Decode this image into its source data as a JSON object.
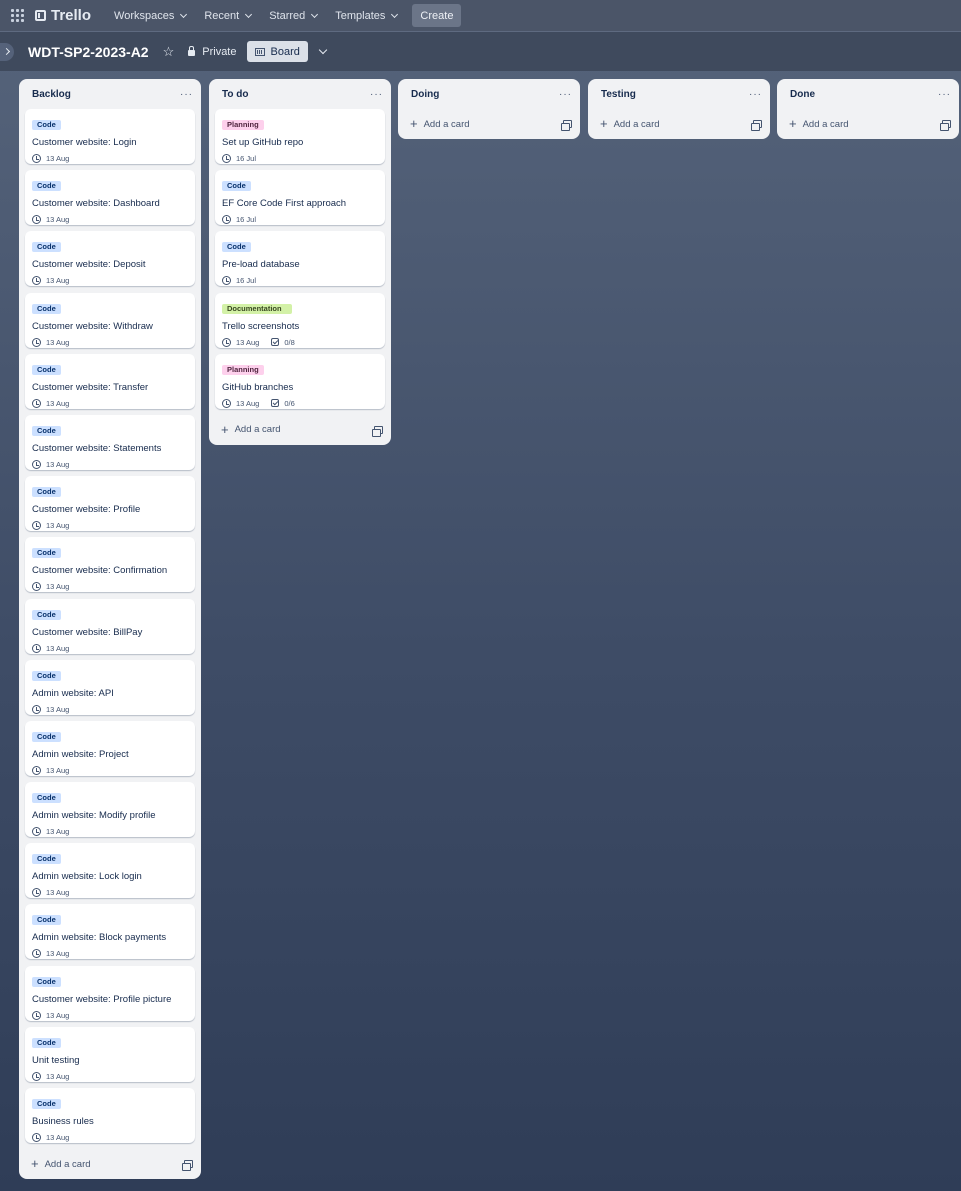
{
  "topbar": {
    "app_name": "Trello",
    "nav": [
      {
        "label": "Workspaces"
      },
      {
        "label": "Recent"
      },
      {
        "label": "Starred"
      },
      {
        "label": "Templates"
      }
    ],
    "create_label": "Create"
  },
  "board": {
    "title": "WDT-SP2-2023-A2",
    "visibility": "Private",
    "view_label": "Board",
    "add_card_label": "Add a card"
  },
  "lists": [
    {
      "title": "Backlog",
      "cards": [
        {
          "label": "Code",
          "label_type": "code",
          "title": "Customer website: Login",
          "date": "13 Aug"
        },
        {
          "label": "Code",
          "label_type": "code",
          "title": "Customer website: Dashboard",
          "date": "13 Aug"
        },
        {
          "label": "Code",
          "label_type": "code",
          "title": "Customer website: Deposit",
          "date": "13 Aug"
        },
        {
          "label": "Code",
          "label_type": "code",
          "title": "Customer website: Withdraw",
          "date": "13 Aug"
        },
        {
          "label": "Code",
          "label_type": "code",
          "title": "Customer website: Transfer",
          "date": "13 Aug"
        },
        {
          "label": "Code",
          "label_type": "code",
          "title": "Customer website: Statements",
          "date": "13 Aug"
        },
        {
          "label": "Code",
          "label_type": "code",
          "title": "Customer website: Profile",
          "date": "13 Aug"
        },
        {
          "label": "Code",
          "label_type": "code",
          "title": "Customer website: Confirmation",
          "date": "13 Aug"
        },
        {
          "label": "Code",
          "label_type": "code",
          "title": "Customer website: BillPay",
          "date": "13 Aug"
        },
        {
          "label": "Code",
          "label_type": "code",
          "title": "Admin website: API",
          "date": "13 Aug"
        },
        {
          "label": "Code",
          "label_type": "code",
          "title": "Admin website: Project",
          "date": "13 Aug"
        },
        {
          "label": "Code",
          "label_type": "code",
          "title": "Admin website: Modify profile",
          "date": "13 Aug"
        },
        {
          "label": "Code",
          "label_type": "code",
          "title": "Admin website: Lock login",
          "date": "13 Aug"
        },
        {
          "label": "Code",
          "label_type": "code",
          "title": "Admin website: Block payments",
          "date": "13 Aug"
        },
        {
          "label": "Code",
          "label_type": "code",
          "title": "Customer website: Profile picture",
          "date": "13 Aug"
        },
        {
          "label": "Code",
          "label_type": "code",
          "title": "Unit testing",
          "date": "13 Aug"
        },
        {
          "label": "Code",
          "label_type": "code",
          "title": "Business rules",
          "date": "13 Aug"
        }
      ]
    },
    {
      "title": "To do",
      "cards": [
        {
          "label": "Planning",
          "label_type": "planning",
          "title": "Set up GitHub repo",
          "date": "16 Jul"
        },
        {
          "label": "Code",
          "label_type": "code",
          "title": "EF Core Code First approach",
          "date": "16 Jul"
        },
        {
          "label": "Code",
          "label_type": "code",
          "title": "Pre-load database",
          "date": "16 Jul"
        },
        {
          "label": "Documentation",
          "label_type": "documentation",
          "title": "Trello screenshots",
          "date": "13 Aug",
          "checklist": "0/8"
        },
        {
          "label": "Planning",
          "label_type": "planning",
          "title": "GitHub branches",
          "date": "13 Aug",
          "checklist": "0/6"
        }
      ]
    },
    {
      "title": "Doing",
      "cards": []
    },
    {
      "title": "Testing",
      "cards": []
    },
    {
      "title": "Done",
      "cards": []
    }
  ],
  "colors": {
    "code_label": "#cce0ff",
    "planning_label": "#fdd0ec",
    "documentation_label": "#d3f1a7",
    "list_bg": "#f1f2f4"
  }
}
